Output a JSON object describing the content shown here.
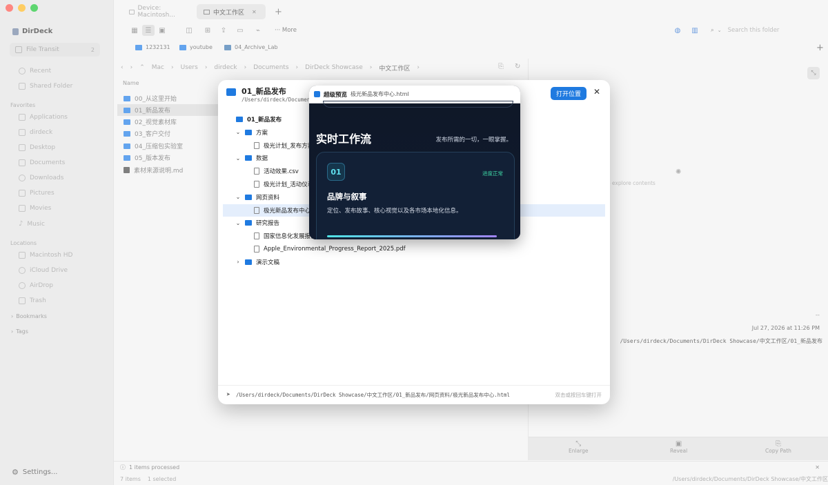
{
  "window": {
    "traffic_lights": [
      "#fe5f57",
      "#febc2e",
      "#28c840"
    ]
  },
  "sidebar": {
    "app_name": "DirDeck",
    "file_transit": {
      "label": "File Transit",
      "badge": "2"
    },
    "top_items": [
      "Recent",
      "Shared Folder"
    ],
    "favorites_header": "Favorites",
    "favorites": [
      "Applications",
      "dirdeck",
      "Desktop",
      "Documents",
      "Downloads",
      "Pictures",
      "Movies",
      "Music"
    ],
    "locations_header": "Locations",
    "locations": [
      "Macintosh HD",
      "iCloud Drive",
      "AirDrop",
      "Trash"
    ],
    "bookmarks": "Bookmarks",
    "tags": "Tags",
    "settings": "Settings..."
  },
  "tabs": [
    {
      "label": "Device: Macintosh..."
    },
    {
      "label": "中文工作区",
      "close": "✕"
    }
  ],
  "tab_add": "+",
  "toolbar": {
    "more": "··· More",
    "search_placeholder": "Search this folder"
  },
  "bookmark_bar": [
    "1232131",
    "youtube",
    "04_Archive_Lab"
  ],
  "bookmark_add": "+",
  "path": [
    "Mac",
    "Users",
    "dirdeck",
    "Documents",
    "DirDeck Showcase",
    "中文工作区"
  ],
  "list": {
    "column_name": "Name",
    "rows": [
      "00_从这里开始",
      "01_新品发布",
      "02_视觉素材库",
      "03_客户交付",
      "04_压缩包实验室",
      "05_版本发布",
      "素材来源说明.md"
    ],
    "selected_index": 1
  },
  "right_pane": {
    "hint": "to explore contents",
    "dash": "--",
    "date": "Jul 27, 2026 at 11:26 PM",
    "path": "/Users/dirdeck/Documents/DirDeck Showcase/中文工作区/01_新品发布",
    "actions": [
      "Enlarge",
      "Reveal",
      "Copy Path"
    ]
  },
  "status": {
    "processed": "1 items processed",
    "items": "7 items",
    "selected": "1 selected",
    "path": "/Users/dirdeck/Documents/DirDeck Showcase/中文工作区"
  },
  "modal": {
    "title": "01_新品发布",
    "subtitle": "/Users/dirdeck/Documents/",
    "open_button": "打开位置",
    "close": "✕",
    "tree": [
      {
        "label": "01_新品发布",
        "type": "folder",
        "level": 0,
        "chev": ""
      },
      {
        "label": "方案",
        "type": "folder",
        "level": 1,
        "chev": "⌄"
      },
      {
        "label": "极光计划_发布方案",
        "type": "file",
        "level": 2,
        "chev": ""
      },
      {
        "label": "数据",
        "type": "folder",
        "level": 1,
        "chev": "⌄"
      },
      {
        "label": "活动效果.csv",
        "type": "file",
        "level": 2,
        "chev": ""
      },
      {
        "label": "极光计划_活动仪表",
        "type": "file",
        "level": 2,
        "chev": ""
      },
      {
        "label": "网页资料",
        "type": "folder",
        "level": 1,
        "chev": "⌄"
      },
      {
        "label": "极光新品发布中心.",
        "type": "file",
        "level": 2,
        "chev": "",
        "selected": true
      },
      {
        "label": "研究报告",
        "type": "folder",
        "level": 1,
        "chev": "⌄"
      },
      {
        "label": "国家信息化发展报告",
        "type": "file",
        "level": 2,
        "chev": ""
      },
      {
        "label": "Apple_Environmental_Progress_Report_2025.pdf",
        "type": "file",
        "level": 2,
        "chev": ""
      },
      {
        "label": "演示文稿",
        "type": "folder",
        "level": 1,
        "chev": "›"
      }
    ],
    "footer_path": "/Users/dirdeck/Documents/DirDeck Showcase/中文工作区/01_新品发布/网页资料/极光新品发布中心.html",
    "footer_hint": "双击或按回车键打开"
  },
  "preview": {
    "label": "超级预览",
    "filename": "极光新品发布中心.html",
    "heading": "实时工作流",
    "subheading": "发布所需的一切，一眼掌握。",
    "card": {
      "number": "01",
      "status": "进度正常",
      "title": "品牌与叙事",
      "desc": "定位、发布故事、核心视觉以及各市场本地化信息。"
    }
  }
}
